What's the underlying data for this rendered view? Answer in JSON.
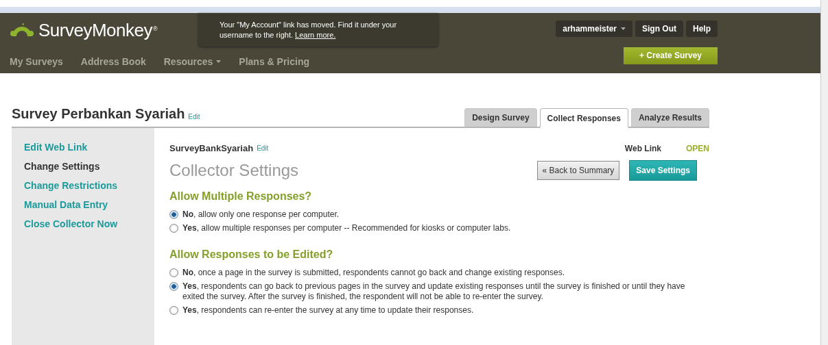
{
  "header": {
    "logo": "SurveyMonkey",
    "logo_mark": "®",
    "notice": "Your \"My Account\" link has moved. Find it under your username to the right.",
    "notice_link": "Learn more.",
    "user_menu": "arhammeister",
    "sign_out": "Sign Out",
    "help": "Help",
    "create_button": "+ Create Survey",
    "nav": [
      {
        "label": "My Surveys",
        "dropdown": false
      },
      {
        "label": "Address Book",
        "dropdown": false
      },
      {
        "label": "Resources",
        "dropdown": true
      },
      {
        "label": "Plans & Pricing",
        "dropdown": false
      }
    ]
  },
  "survey": {
    "title": "Survey Perbankan Syariah",
    "edit": "Edit"
  },
  "tabs": [
    {
      "label": "Design Survey",
      "selected": false
    },
    {
      "label": "Collect Responses",
      "selected": true
    },
    {
      "label": "Analyze Results",
      "selected": false
    }
  ],
  "sidebar": {
    "items": [
      {
        "label": "Edit Web Link",
        "selected": false
      },
      {
        "label": "Change Settings",
        "selected": true
      },
      {
        "label": "Change Restrictions",
        "selected": false
      },
      {
        "label": "Manual Data Entry",
        "selected": false
      },
      {
        "label": "Close Collector Now",
        "selected": false
      }
    ]
  },
  "collector": {
    "name": "SurveyBankSyariah",
    "edit": "Edit",
    "type": "Web Link",
    "status": "OPEN",
    "heading": "Collector Settings",
    "back_button": "« Back to Summary",
    "save_button": "Save Settings"
  },
  "sections": [
    {
      "heading": "Allow Multiple Responses?",
      "options": [
        {
          "text": "**No**, allow only one response per computer.",
          "selected": true
        },
        {
          "text": "**Yes**, allow multiple responses per computer -- Recommended for kiosks or computer labs.",
          "selected": false
        }
      ]
    },
    {
      "heading": "Allow Responses to be Edited?",
      "options": [
        {
          "text": "**No**, once a page in the survey is submitted, respondents cannot go back and change existing responses.",
          "selected": false
        },
        {
          "text": "**Yes**, respondents can go back to previous pages in the survey and update existing responses until the survey is finished or until they have exited the survey. After the survey is finished, the respondent will not be able to re-enter the survey.",
          "selected": true
        },
        {
          "text": "**Yes**, respondents can re-enter the survey at any time to update their responses.",
          "selected": false
        }
      ]
    }
  ]
}
